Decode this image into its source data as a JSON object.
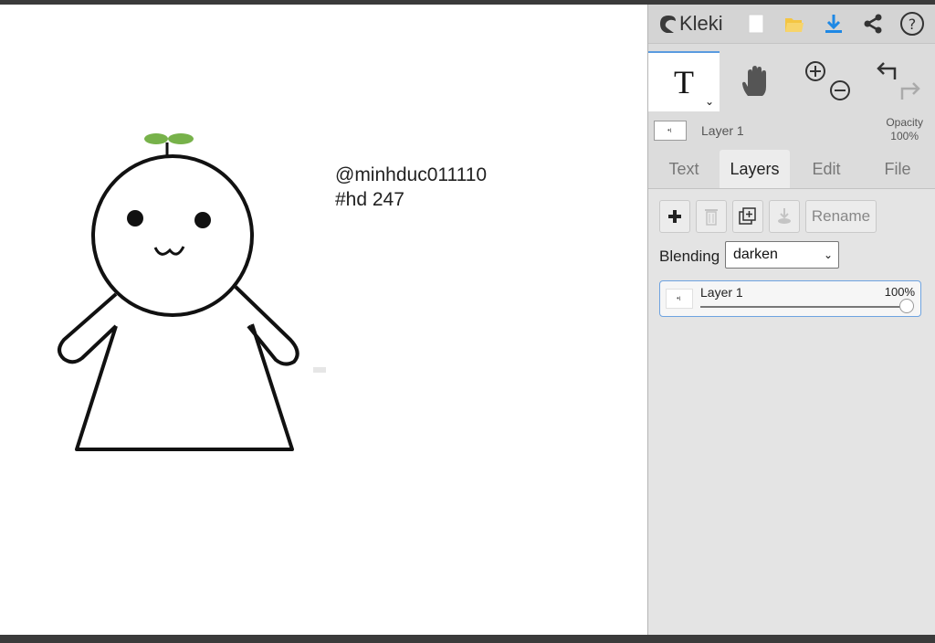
{
  "app": {
    "name": "Kleki"
  },
  "canvas": {
    "text_lines": [
      "@minhduc011110",
      "#hd 247"
    ]
  },
  "header": {
    "icons": [
      "new-file-icon",
      "open-folder-icon",
      "download-icon",
      "share-icon",
      "help-icon"
    ]
  },
  "tools": {
    "active_tool_glyph": "T",
    "hand_icon": "hand-icon",
    "zoom_in_icon": "zoom-in-icon",
    "zoom_out_icon": "zoom-out-icon",
    "undo_icon": "undo-icon",
    "redo_icon": "redo-icon"
  },
  "current_layer": {
    "name": "Layer 1",
    "opacity_label": "Opacity",
    "opacity_value": "100%"
  },
  "tabs": [
    {
      "label": "Text",
      "active": false
    },
    {
      "label": "Layers",
      "active": true
    },
    {
      "label": "Edit",
      "active": false
    },
    {
      "label": "File",
      "active": false
    }
  ],
  "layers_panel": {
    "rename_label": "Rename",
    "blending_label": "Blending",
    "blending_value": "darken",
    "layers": [
      {
        "name": "Layer 1",
        "opacity": "100%",
        "opacity_fraction": 1.0
      }
    ]
  },
  "colors": {
    "accent_blue": "#1e88e5",
    "folder_yellow": "#f4c542",
    "sprout_green": "#77b24a",
    "panel_bg": "#dcdcdc"
  }
}
